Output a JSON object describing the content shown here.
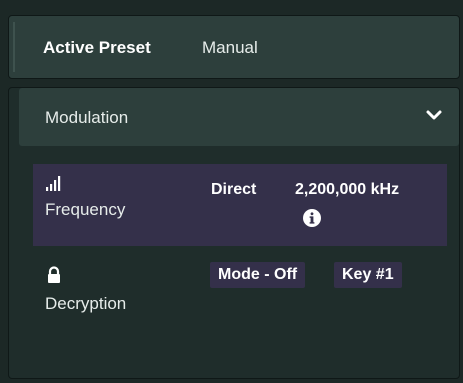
{
  "preset": {
    "label": "Active Preset",
    "value": "Manual"
  },
  "modulation": {
    "title": "Modulation",
    "expanded": true,
    "frequency": {
      "label": "Frequency",
      "icon": "signal-bars-icon",
      "mode": "Direct",
      "value": "2,200,000 kHz",
      "info_icon": "info-icon"
    },
    "decryption": {
      "label": "Decryption",
      "icon": "lock-icon",
      "mode": "Mode - Off",
      "key": "Key #1"
    }
  },
  "colors": {
    "background": "#1c2826",
    "card": "#2d3f3c",
    "highlight": "#34304a",
    "text": "#e6ecea"
  }
}
